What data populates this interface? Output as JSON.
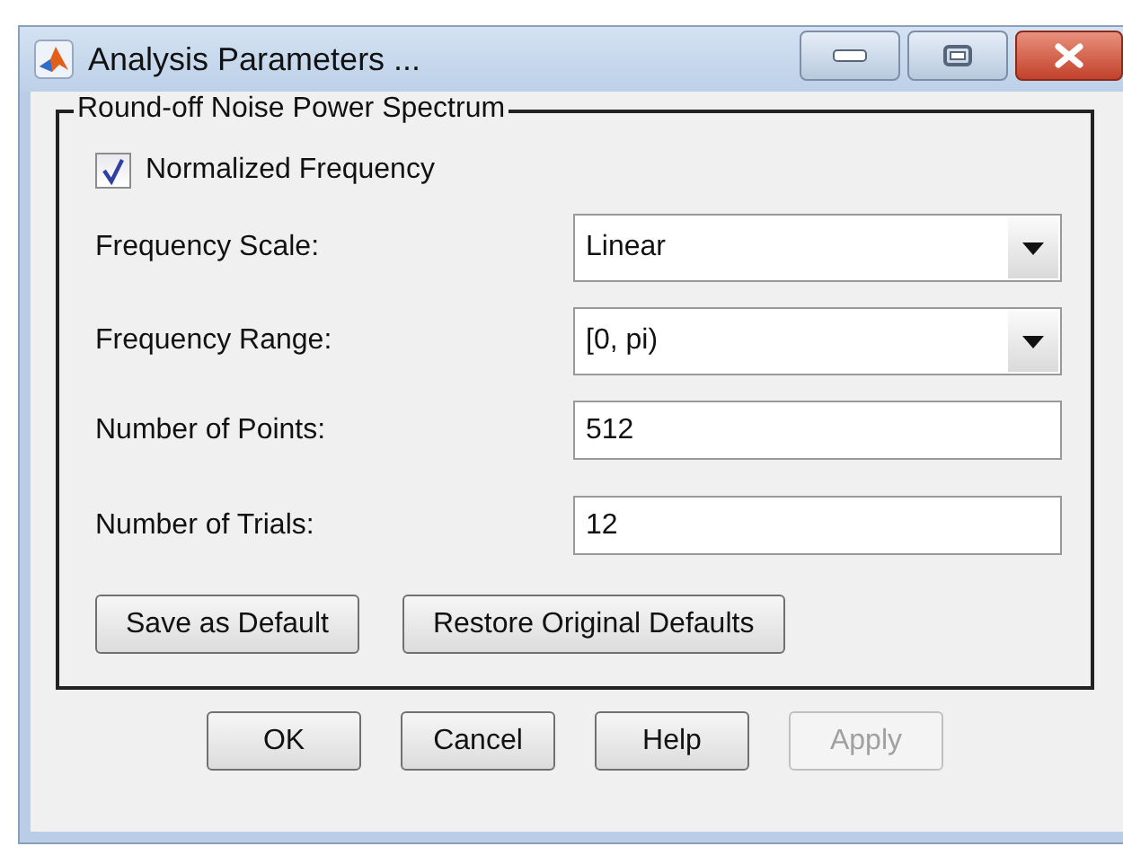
{
  "window": {
    "title": "Analysis Parameters ..."
  },
  "group": {
    "title": "Round-off Noise Power Spectrum"
  },
  "checkbox": {
    "label": "Normalized Frequency",
    "checked": true
  },
  "fields": [
    {
      "label": "Frequency Scale:",
      "kind": "dropdown",
      "value": "Linear"
    },
    {
      "label": "Frequency Range:",
      "kind": "dropdown",
      "value": "[0, pi)"
    },
    {
      "label": "Number of Points:",
      "kind": "text",
      "value": "512"
    },
    {
      "label": "Number of Trials:",
      "kind": "text",
      "value": "12"
    }
  ],
  "group_buttons": [
    "Save as Default",
    "Restore Original Defaults"
  ],
  "dialog_buttons": [
    {
      "label": "OK",
      "disabled": false
    },
    {
      "label": "Cancel",
      "disabled": false
    },
    {
      "label": "Help",
      "disabled": false
    },
    {
      "label": "Apply",
      "disabled": true
    }
  ]
}
